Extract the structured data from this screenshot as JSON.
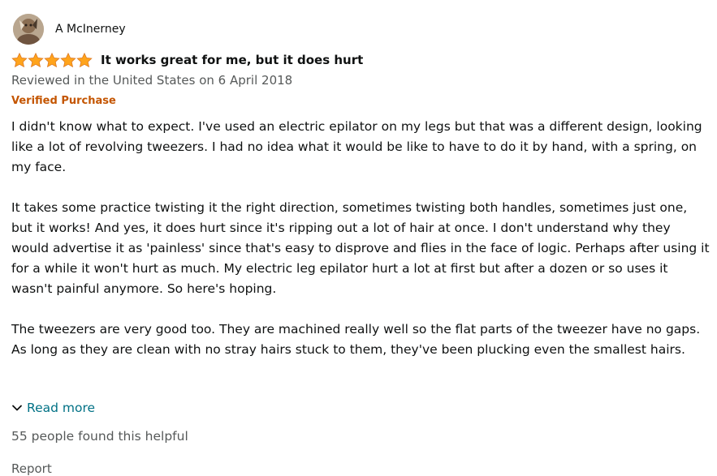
{
  "reviewer": {
    "name": "A McInerney",
    "avatar_icon": "user-avatar-photo"
  },
  "rating": {
    "stars": 5,
    "max": 5,
    "color": "#ffa41c"
  },
  "review": {
    "title": "It works great for me, but it does hurt",
    "date": "Reviewed in the United States on 6 April 2018",
    "badge": "Verified Purchase",
    "paragraphs": [
      "I didn't know what to expect. I've used an electric epilator on my legs but that was a different design, looking like a lot of revolving tweezers. I had no idea what it would be like to have to do it by hand, with a spring, on my face.",
      "It takes some practice twisting it the right direction, sometimes twisting both handles, sometimes just one, but it works! And yes, it does hurt since it's ripping out a lot of hair at once. I don't understand why they would advertise it as 'painless' since that's easy to disprove and flies in the face of logic. Perhaps after using it for a while it won't hurt as much. My electric leg epilator hurt a lot at first but after a dozen or so uses it wasn't painful anymore. So here's hoping.",
      "The tweezers are very good too. They are machined really well so the flat parts of the tweezer have no gaps. As long as they are clean with no stray hairs stuck to them, they've been plucking even the smallest hairs."
    ]
  },
  "actions": {
    "read_more": "Read more",
    "helpful_text": "55 people found this helpful",
    "report": "Report"
  },
  "colors": {
    "link": "#007185",
    "verified": "#c45500",
    "secondary_text": "#565959",
    "star": "#ffa41c"
  }
}
